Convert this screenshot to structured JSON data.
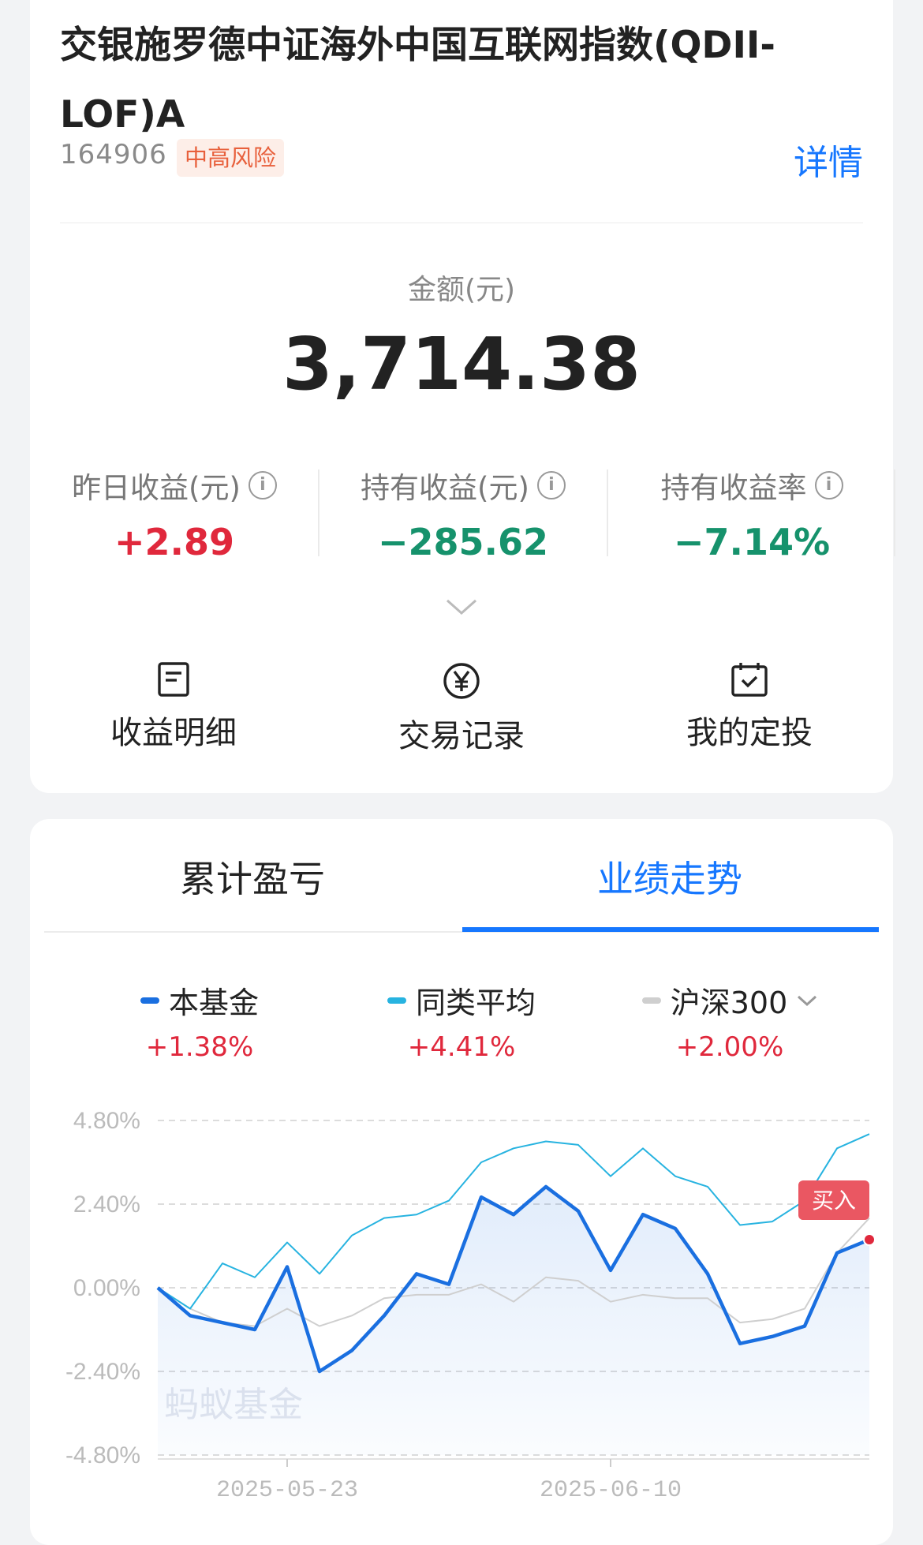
{
  "fund": {
    "title": "交银施罗德中证海外中国互联网指数(QDII-LOF)A",
    "code": "164906",
    "risk": "中高风险",
    "detail_label": "详情"
  },
  "holding": {
    "amount_label": "金额(元)",
    "amount": "3,714.38",
    "stats": [
      {
        "label": "昨日收益(元)",
        "value": "+2.89",
        "color": "#e0283c"
      },
      {
        "label": "持有收益(元)",
        "value": "−285.62",
        "color": "#16926c"
      },
      {
        "label": "持有收益率",
        "value": "−7.14%",
        "color": "#16926c"
      }
    ],
    "info_glyph": "i"
  },
  "actions": [
    {
      "label": "收益明细",
      "icon": "document-icon"
    },
    {
      "label": "交易记录",
      "icon": "yen-coin-icon"
    },
    {
      "label": "我的定投",
      "icon": "calendar-check-icon"
    }
  ],
  "tabs": [
    {
      "label": "累计盈亏",
      "active": false
    },
    {
      "label": "业绩走势",
      "active": true
    }
  ],
  "legend": [
    {
      "name": "本基金",
      "value": "+1.38%",
      "color": "#1a6fe0"
    },
    {
      "name": "同类平均",
      "value": "+4.41%",
      "color": "#27b3e0"
    },
    {
      "name": "沪深300",
      "value": "+2.00%",
      "color": "#cfcfcf"
    }
  ],
  "chart_data": {
    "type": "line",
    "x_ticks": [
      "2025-05-23",
      "2025-06-10"
    ],
    "y_ticks": [
      "4.80%",
      "2.40%",
      "0.00%",
      "-2.40%",
      "-4.80%"
    ],
    "ylim": [
      -4.8,
      4.8
    ],
    "grid": true,
    "watermark": "蚂蚁基金",
    "marker_label": "买入",
    "series": [
      {
        "name": "本基金",
        "color": "#1a6fe0",
        "values": [
          0.0,
          -0.8,
          -1.0,
          -1.2,
          0.6,
          -2.4,
          -1.8,
          -0.8,
          0.4,
          0.1,
          2.6,
          2.1,
          2.9,
          2.2,
          0.5,
          2.1,
          1.7,
          0.4,
          -1.6,
          -1.4,
          -1.1,
          1.0,
          1.38
        ]
      },
      {
        "name": "同类平均",
        "color": "#27b3e0",
        "values": [
          0.0,
          -0.6,
          0.7,
          0.3,
          1.3,
          0.4,
          1.5,
          2.0,
          2.1,
          2.5,
          3.6,
          4.0,
          4.2,
          4.1,
          3.2,
          4.0,
          3.2,
          2.9,
          1.8,
          1.9,
          2.5,
          4.0,
          4.41
        ]
      },
      {
        "name": "沪深300",
        "color": "#cfcfcf",
        "values": [
          0.0,
          -0.6,
          -1.0,
          -1.1,
          -0.6,
          -1.1,
          -0.8,
          -0.3,
          -0.2,
          -0.2,
          0.1,
          -0.4,
          0.3,
          0.2,
          -0.4,
          -0.2,
          -0.3,
          -0.3,
          -1.0,
          -0.9,
          -0.6,
          1.0,
          2.0
        ]
      }
    ]
  }
}
